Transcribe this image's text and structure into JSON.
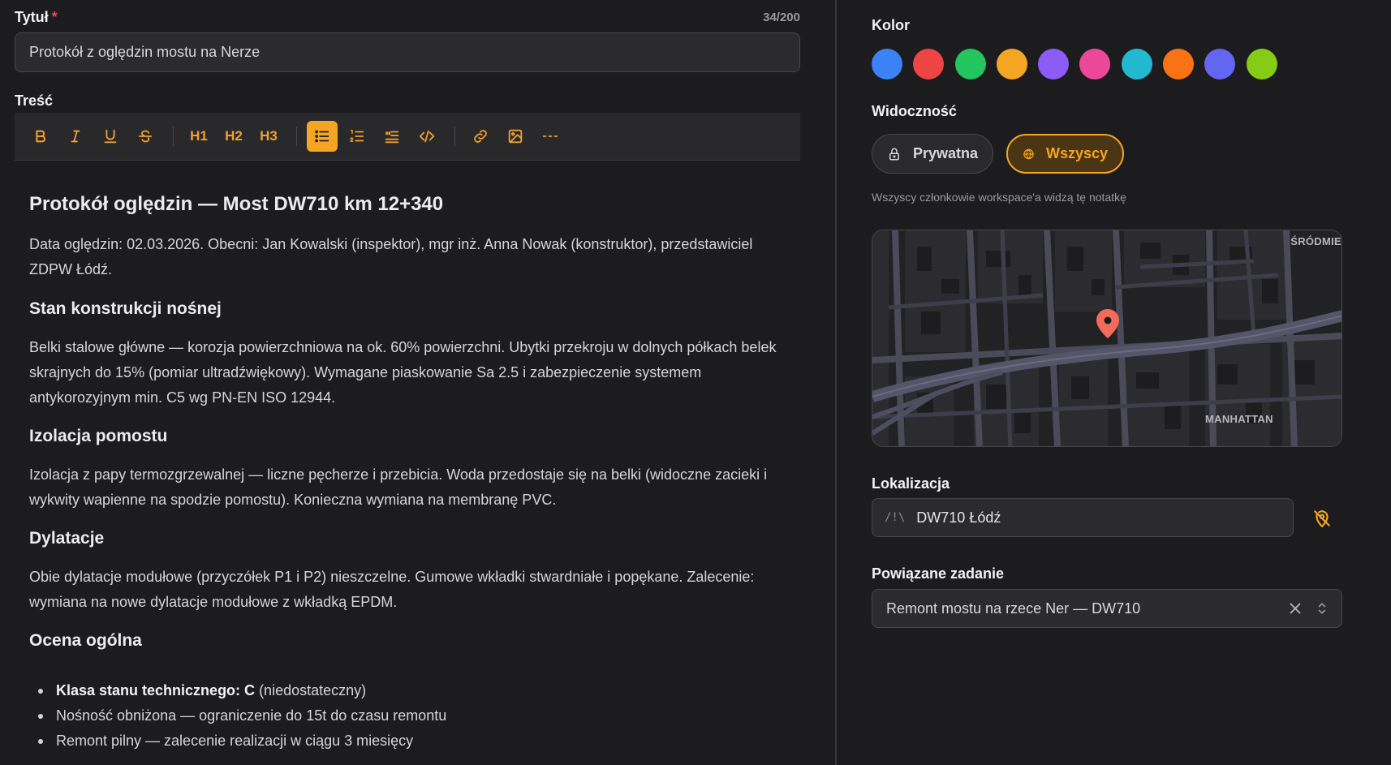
{
  "editor": {
    "title_label": "Tytuł",
    "required_mark": "*",
    "title_counter": "34/200",
    "title_value": "Protokół z oględzin mostu na Nerze",
    "content_label": "Treść",
    "toolbar": {
      "heading1": "H1",
      "heading2": "H2",
      "heading3": "H3"
    }
  },
  "document": {
    "h1": "Protokół oględzin — Most DW710 km 12+340",
    "intro": "Data oględzin: 02.03.2026. Obecni: Jan Kowalski (inspektor), mgr inż. Anna Nowak (konstruktor), przedstawiciel ZDPW Łódź.",
    "sections": [
      {
        "heading": "Stan konstrukcji nośnej",
        "body": "Belki stalowe główne — korozja powierzchniowa na ok. 60% powierzchni. Ubytki przekroju w dolnych półkach belek skrajnych do 15% (pomiar ultradźwiękowy). Wymagane piaskowanie Sa 2.5 i zabezpieczenie systemem antykorozyjnym min. C5 wg PN-EN ISO 12944."
      },
      {
        "heading": "Izolacja pomostu",
        "body": "Izolacja z papy termozgrzewalnej — liczne pęcherze i przebicia. Woda przedostaje się na belki (widoczne zacieki i wykwity wapienne na spodzie pomostu). Konieczna wymiana na membranę PVC."
      },
      {
        "heading": "Dylatacje",
        "body": "Obie dylatacje modułowe (przyczółek P1 i P2) nieszczelne. Gumowe wkładki stwardniałe i popękane. Zalecenie: wymiana na nowe dylatacje modułowe z wkładką EPDM."
      },
      {
        "heading": "Ocena ogólna"
      }
    ],
    "bullets": [
      {
        "bold": "Klasa stanu technicznego: C",
        "rest": " (niedostateczny)"
      },
      {
        "bold": "",
        "rest": "Nośność obniżona — ograniczenie do 15t do czasu remontu"
      },
      {
        "bold": "",
        "rest": "Remont pilny — zalecenie realizacji w ciągu 3 miesięcy"
      }
    ]
  },
  "sidebar": {
    "color_label": "Kolor",
    "colors": [
      "#3b82f6",
      "#ef4444",
      "#22c55e",
      "#f5a524",
      "#8b5cf6",
      "#ec4899",
      "#22b8cf",
      "#f97316",
      "#6366f1",
      "#84cc16"
    ],
    "selected_color": "#f5a524",
    "visibility_label": "Widoczność",
    "visibility_private": "Prywatna",
    "visibility_all": "Wszyscy",
    "visibility_selected": "Wszyscy",
    "visibility_help": "Wszyscy członkowie workspace'a widzą tę notatkę",
    "map": {
      "label_top": "ŚRÓDMIE",
      "label_bottom": "MANHATTAN",
      "pin_color": "#f26b5b"
    },
    "location_label": "Lokalizacja",
    "location_prefix": "/!\\",
    "location_value": "DW710 Łódź",
    "task_label": "Powiązane zadanie",
    "task_value": "Remont mostu na rzece Ner — DW710"
  }
}
